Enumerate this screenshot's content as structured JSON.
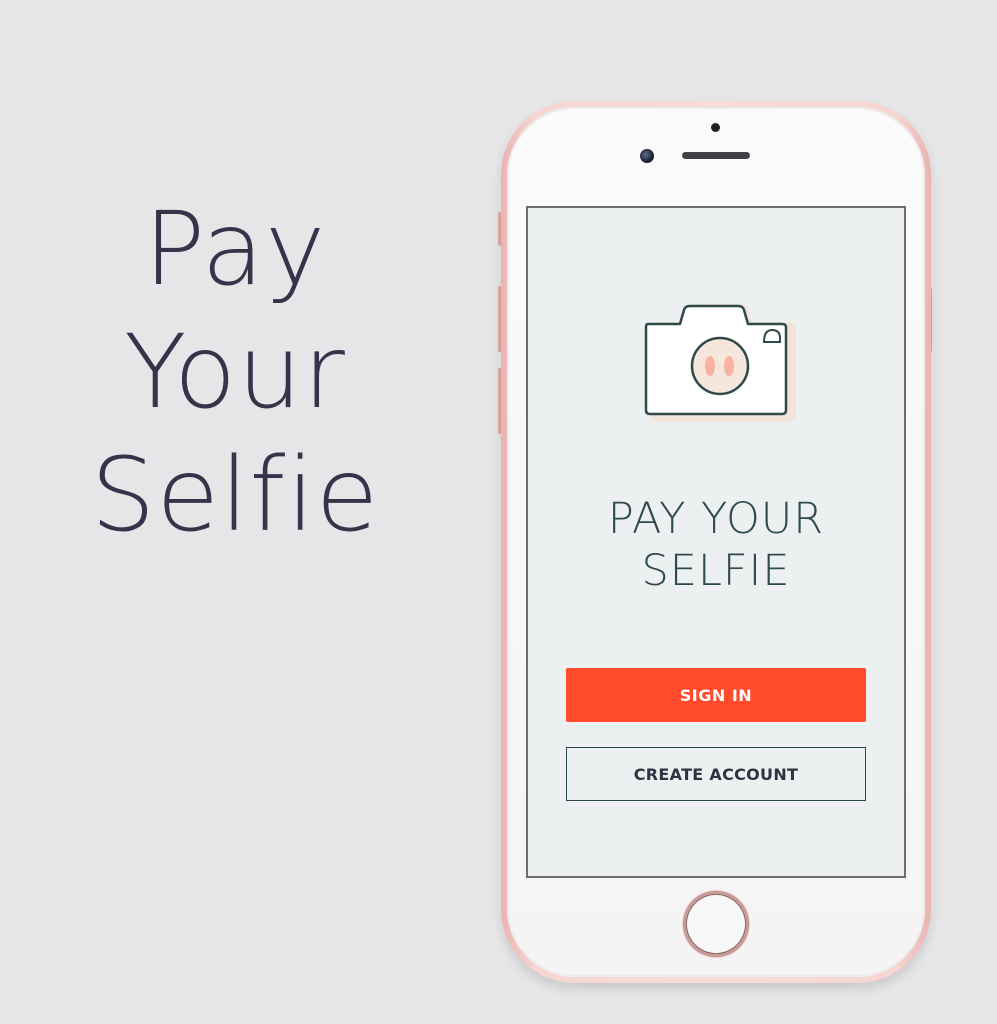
{
  "headline": {
    "lines": [
      "Pay",
      "Your",
      "Selfie"
    ]
  },
  "screen": {
    "logo_icon": "camera-icon",
    "title_lines": [
      "PAY YOUR",
      "SELFIE"
    ],
    "sign_in_label": "SIGN IN",
    "create_account_label": "CREATE ACCOUNT"
  },
  "colors": {
    "background": "#e6e6e8",
    "headline_text": "#35344a",
    "screen_background": "#edf0f1",
    "title_text": "#2f4a4a",
    "primary_button": "#ff4a2c",
    "phone_frame": "#f6d6d2"
  }
}
